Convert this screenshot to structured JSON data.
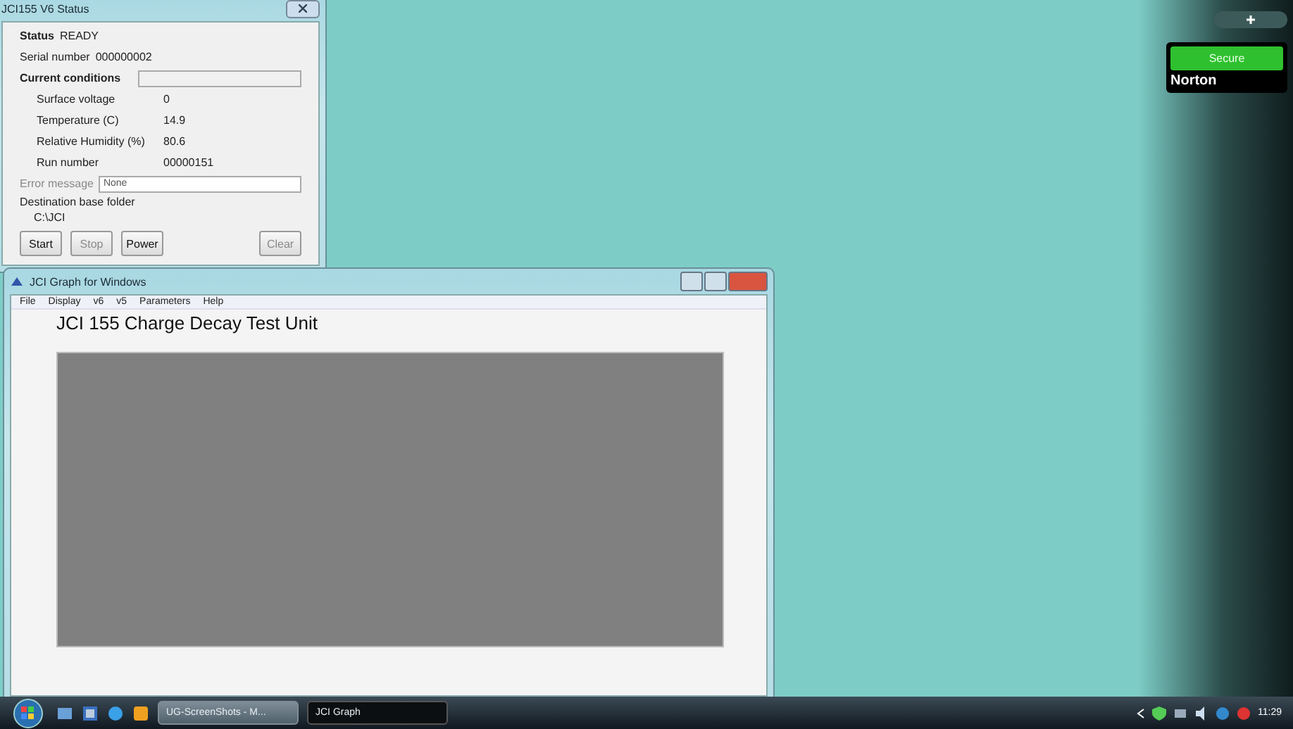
{
  "status_window": {
    "title": "JCI155 V6 Status",
    "status": {
      "label": "Status",
      "value": "READY"
    },
    "serial": {
      "label": "Serial number",
      "value": "000000002"
    },
    "conditions_heading": "Current conditions",
    "conditions": [
      {
        "label": "Surface voltage",
        "value": "0"
      },
      {
        "label": "Temperature (C)",
        "value": "14.9"
      },
      {
        "label": "Relative Humidity (%)",
        "value": "80.6"
      },
      {
        "label": "Run number",
        "value": "00000151"
      }
    ],
    "error_message": {
      "label": "Error message",
      "value": "None",
      "disabled": true
    },
    "destination": {
      "label": "Destination base folder",
      "value": "C:\\JCI"
    },
    "buttons": [
      {
        "label": "Start",
        "disabled": false
      },
      {
        "label": "Stop",
        "disabled": true
      },
      {
        "label": "Power",
        "disabled": false
      },
      {
        "label": "Clear",
        "disabled": true
      }
    ]
  },
  "graph_window": {
    "title": "JCI Graph for Windows",
    "menu": [
      "File",
      "Display",
      "v6",
      "v5",
      "Parameters",
      "Help"
    ],
    "heading": "JCI 155 Charge Decay Test Unit"
  },
  "sidebar": {
    "gadget": {
      "status": "Secure",
      "brand": "Norton"
    }
  },
  "taskbar": {
    "tasks": [
      {
        "label": "UG-ScreenShots - M...",
        "selected": false
      },
      {
        "label": "JCI Graph",
        "selected": true
      }
    ],
    "clock": "11:29"
  }
}
